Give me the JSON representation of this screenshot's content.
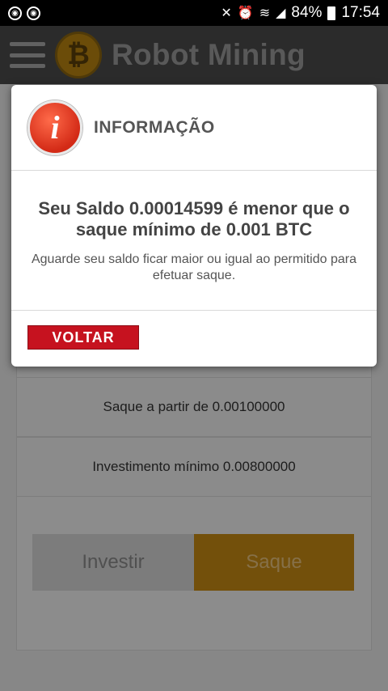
{
  "status_bar": {
    "battery_percent": "84%",
    "time": "17:54",
    "left_icons": [
      "notification-icon",
      "notification-icon"
    ],
    "right_icons": [
      "mute-icon",
      "alarm-icon",
      "wifi-icon",
      "signal-icon",
      "battery-icon"
    ]
  },
  "app_bar": {
    "title": "Robot Mining",
    "logo_glyph": "₿"
  },
  "main": {
    "info_rows": [
      "Saque a partir de 0.00100000",
      "Investimento mínimo 0.00800000"
    ],
    "investir_label": "Investir",
    "saque_label": "Saque"
  },
  "dialog": {
    "icon_glyph": "i",
    "title": "INFORMAÇÃO",
    "message": "Seu Saldo 0.00014599 é menor que o saque mínimo de 0.001 BTC",
    "submessage": "Aguarde seu saldo ficar maior ou igual ao permitido para efetuar saque.",
    "button_label": "VOLTAR"
  },
  "colors": {
    "accent": "#c78a13",
    "dialog_button": "#c6121f",
    "app_bar": "#4a4a4a"
  }
}
